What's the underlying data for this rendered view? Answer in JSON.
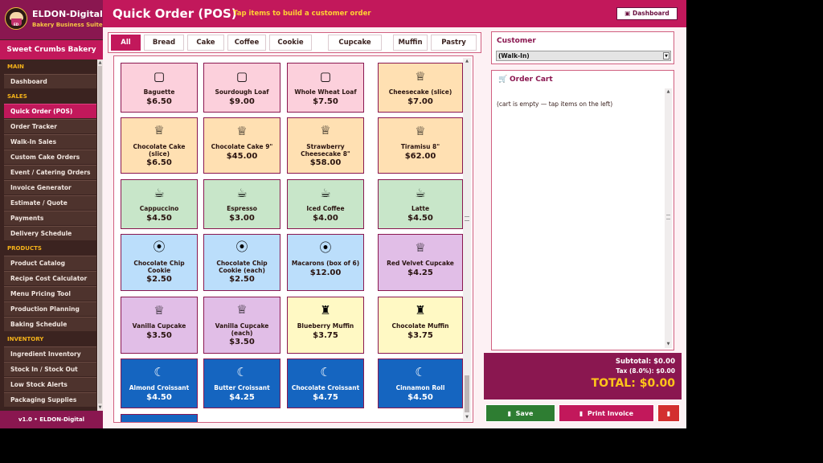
{
  "brand": {
    "title": "ELDON-Digital",
    "subtitle": "Bakery Business Suite",
    "logo_tag": "ED"
  },
  "store_name": "Sweet Crumbs Bakery",
  "sidebar": {
    "sections": [
      {
        "label": "MAIN",
        "items": [
          {
            "label": "Dashboard"
          }
        ]
      },
      {
        "label": "SALES",
        "items": [
          {
            "label": "Quick Order (POS)",
            "active": true
          },
          {
            "label": "Order Tracker"
          },
          {
            "label": "Walk-In Sales"
          },
          {
            "label": "Custom Cake Orders"
          },
          {
            "label": "Event / Catering Orders"
          },
          {
            "label": "Invoice Generator"
          },
          {
            "label": "Estimate / Quote"
          },
          {
            "label": "Payments"
          },
          {
            "label": "Delivery Schedule"
          }
        ]
      },
      {
        "label": "PRODUCTS",
        "items": [
          {
            "label": "Product Catalog"
          },
          {
            "label": "Recipe Cost Calculator"
          },
          {
            "label": "Menu Pricing Tool"
          },
          {
            "label": "Production Planning"
          },
          {
            "label": "Baking Schedule"
          }
        ]
      },
      {
        "label": "INVENTORY",
        "items": [
          {
            "label": "Ingredient Inventory"
          },
          {
            "label": "Stock In / Stock Out"
          },
          {
            "label": "Low Stock Alerts"
          },
          {
            "label": "Packaging Supplies"
          }
        ]
      }
    ]
  },
  "version": "v1.0  •  ELDON-Digital",
  "header": {
    "title": "Quick Order (POS)",
    "subtitle": "Tap items to build a customer order",
    "dashboard_button": "Dashboard",
    "dashboard_icon": "▣"
  },
  "tabs": [
    "All",
    "Bread",
    "Cake",
    "Coffee",
    "Cookie",
    "Cupcake",
    "Muffin",
    "Pastry"
  ],
  "active_tab": "All",
  "colors": {
    "bread": "#fcd0dc",
    "cake": "#ffe0b2",
    "coffee": "#c8e6c9",
    "cookie": "#bbdefb",
    "cupcake": "#e1bee7",
    "muffin": "#fff9c4",
    "pastry": "#1565c0"
  },
  "products": [
    {
      "name": "Baguette",
      "price": "$6.50",
      "cat": "bread",
      "icon": "bread-icon"
    },
    {
      "name": "Sourdough Loaf",
      "price": "$9.00",
      "cat": "bread",
      "icon": "bread-icon"
    },
    {
      "name": "Whole Wheat Loaf",
      "price": "$7.50",
      "cat": "bread",
      "icon": "bread-icon"
    },
    {
      "name": "Cheesecake (slice)",
      "price": "$7.00",
      "cat": "cake",
      "icon": "cake-icon"
    },
    {
      "name": "Chocolate Cake (slice)",
      "price": "$6.50",
      "cat": "cake",
      "icon": "cake-icon"
    },
    {
      "name": "Chocolate Cake 9\"",
      "price": "$45.00",
      "cat": "cake",
      "icon": "cake-icon"
    },
    {
      "name": "Strawberry Cheesecake 8\"",
      "price": "$58.00",
      "cat": "cake",
      "icon": "cake-icon"
    },
    {
      "name": "Tiramisu 8\"",
      "price": "$62.00",
      "cat": "cake",
      "icon": "cake-icon"
    },
    {
      "name": "Cappuccino",
      "price": "$4.50",
      "cat": "coffee",
      "icon": "coffee-icon"
    },
    {
      "name": "Espresso",
      "price": "$3.00",
      "cat": "coffee",
      "icon": "coffee-icon"
    },
    {
      "name": "Iced Coffee",
      "price": "$4.00",
      "cat": "coffee",
      "icon": "coffee-icon"
    },
    {
      "name": "Latte",
      "price": "$4.50",
      "cat": "coffee",
      "icon": "coffee-icon"
    },
    {
      "name": "Chocolate Chip Cookie",
      "price": "$2.50",
      "cat": "cookie",
      "icon": "cookie-icon"
    },
    {
      "name": "Chocolate Chip Cookie (each)",
      "price": "$2.50",
      "cat": "cookie",
      "icon": "cookie-icon"
    },
    {
      "name": "Macarons (box of 6)",
      "price": "$12.00",
      "cat": "cookie",
      "icon": "cookie-icon"
    },
    {
      "name": "Red Velvet Cupcake",
      "price": "$4.25",
      "cat": "cupcake",
      "icon": "cake-icon"
    },
    {
      "name": "Vanilla Cupcake",
      "price": "$3.50",
      "cat": "cupcake",
      "icon": "cake-icon"
    },
    {
      "name": "Vanilla Cupcake (each)",
      "price": "$3.50",
      "cat": "cupcake",
      "icon": "cake-icon"
    },
    {
      "name": "Blueberry Muffin",
      "price": "$3.75",
      "cat": "muffin",
      "icon": "muffin-icon"
    },
    {
      "name": "Chocolate Muffin",
      "price": "$3.75",
      "cat": "muffin",
      "icon": "muffin-icon"
    },
    {
      "name": "Almond Croissant",
      "price": "$4.50",
      "cat": "pastry",
      "icon": "croissant-icon"
    },
    {
      "name": "Butter Croissant",
      "price": "$4.25",
      "cat": "pastry",
      "icon": "croissant-icon"
    },
    {
      "name": "Chocolate Croissant",
      "price": "$4.75",
      "cat": "pastry",
      "icon": "croissant-icon"
    },
    {
      "name": "Cinnamon Roll",
      "price": "$4.50",
      "cat": "pastry",
      "icon": "croissant-icon"
    },
    {
      "name": "",
      "price": "",
      "cat": "pastry",
      "icon": ""
    }
  ],
  "customer": {
    "label": "Customer",
    "selected": "(Walk-In)"
  },
  "cart": {
    "title": "Order Cart",
    "empty_text": "(cart is empty — tap items on the left)",
    "icon": "cart-icon"
  },
  "totals": {
    "subtotal": "Subtotal: $0.00",
    "tax": "Tax (8.0%): $0.00",
    "total": "TOTAL: $0.00"
  },
  "actions": {
    "save": "Save",
    "save_icon": "▮",
    "print": "Print Invoice",
    "print_icon": "▮",
    "clear_icon": "▮"
  }
}
